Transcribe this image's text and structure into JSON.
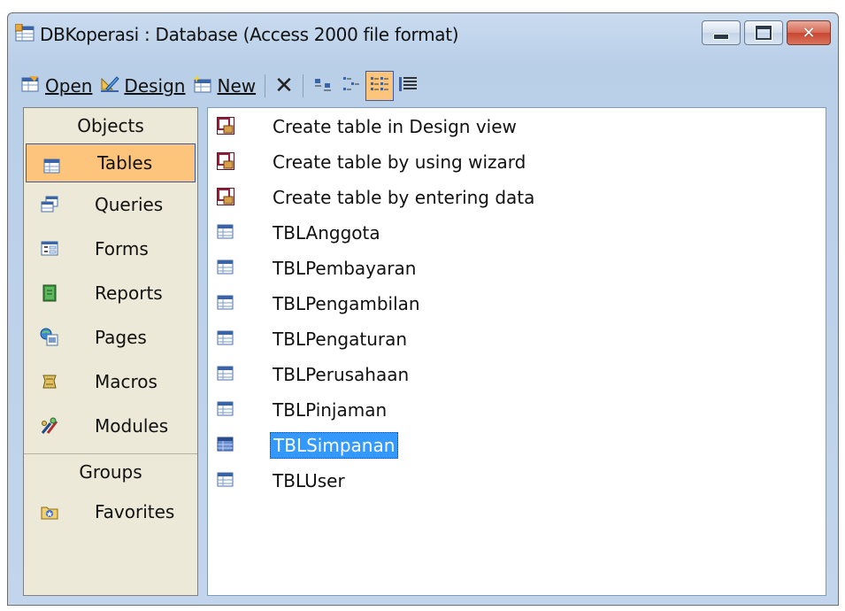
{
  "window": {
    "title": "DBKoperasi : Database (Access 2000 file format)",
    "buttons": [
      "minimize-icon",
      "maximize-icon",
      "close-icon"
    ],
    "close_glyph": "✕"
  },
  "toolbar": {
    "open_label": "Open",
    "design_label": "Design",
    "new_label": "New",
    "delete_glyph": "✕",
    "view_buttons": [
      "large-icons",
      "small-icons",
      "list",
      "details"
    ],
    "active_view": "list"
  },
  "objects": {
    "header": "Objects",
    "items": [
      {
        "label": "Tables",
        "icon": "table-icon",
        "selected": true
      },
      {
        "label": "Queries",
        "icon": "query-icon"
      },
      {
        "label": "Forms",
        "icon": "form-icon"
      },
      {
        "label": "Reports",
        "icon": "report-icon"
      },
      {
        "label": "Pages",
        "icon": "page-icon"
      },
      {
        "label": "Macros",
        "icon": "macro-icon"
      },
      {
        "label": "Modules",
        "icon": "module-icon"
      }
    ]
  },
  "groups": {
    "header": "Groups",
    "items": [
      {
        "label": "Favorites",
        "icon": "favorites-folder-icon"
      }
    ]
  },
  "list": {
    "items": [
      {
        "label": "Create table in Design view",
        "icon": "wizard-icon"
      },
      {
        "label": "Create table by using wizard",
        "icon": "wizard-icon"
      },
      {
        "label": "Create table by entering data",
        "icon": "wizard-icon"
      },
      {
        "label": "TBLAnggota",
        "icon": "table-icon"
      },
      {
        "label": "TBLPembayaran",
        "icon": "table-icon"
      },
      {
        "label": "TBLPengambilan",
        "icon": "table-icon"
      },
      {
        "label": "TBLPengaturan",
        "icon": "table-icon"
      },
      {
        "label": "TBLPerusahaan",
        "icon": "table-icon"
      },
      {
        "label": "TBLPinjaman",
        "icon": "table-icon"
      },
      {
        "label": "TBLSimpanan",
        "icon": "table-icon",
        "selected": true
      },
      {
        "label": "TBLUser",
        "icon": "table-icon"
      }
    ]
  },
  "colors": {
    "selection_blue": "#3399ff",
    "nav_selected": "#fcc57b",
    "pane_bg": "#ece9d8",
    "window_frame": "#c2d5ec"
  }
}
